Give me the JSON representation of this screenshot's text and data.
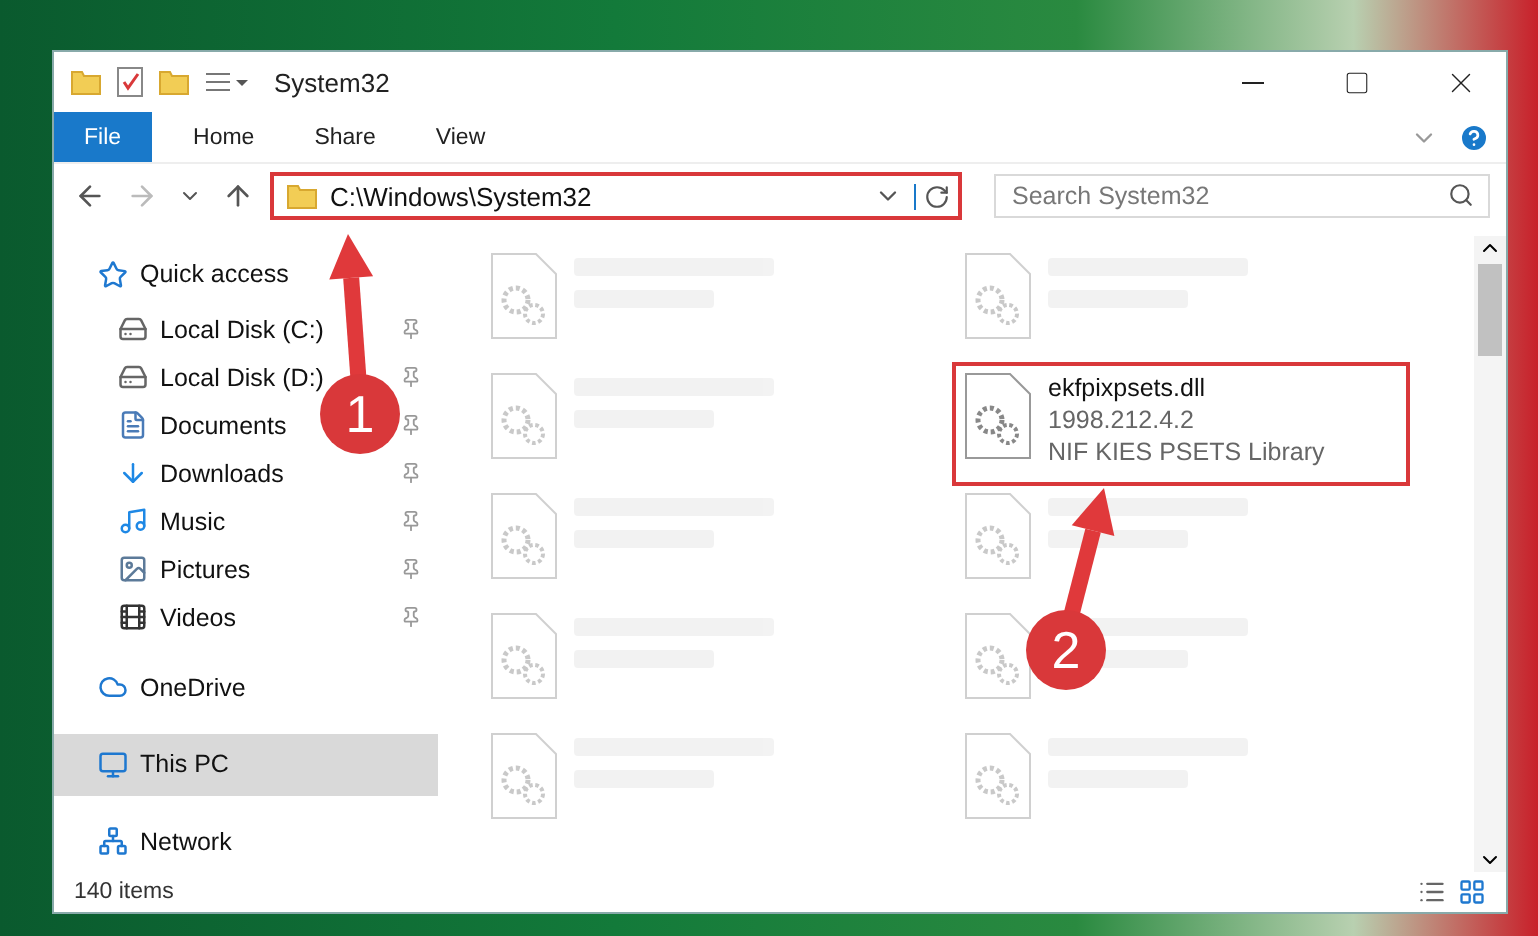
{
  "window": {
    "title": "System32"
  },
  "ribbon": {
    "tabs": [
      {
        "label": "File",
        "kind": "file",
        "selected": false
      },
      {
        "label": "Home",
        "kind": "tab",
        "selected": false
      },
      {
        "label": "Share",
        "kind": "tab",
        "selected": false
      },
      {
        "label": "View",
        "kind": "tab",
        "selected": false
      }
    ]
  },
  "address_bar": {
    "path": "C:\\Windows\\System32",
    "highlighted": true
  },
  "search": {
    "placeholder": "Search System32"
  },
  "navigation": [
    {
      "label": "Quick access",
      "selected": false,
      "children": [
        {
          "label": "Local Disk (C:)",
          "pinned": true
        },
        {
          "label": "Local Disk (D:)",
          "pinned": true
        },
        {
          "label": "Documents",
          "pinned": true
        },
        {
          "label": "Downloads",
          "pinned": true
        },
        {
          "label": "Music",
          "pinned": true
        },
        {
          "label": "Pictures",
          "pinned": true
        },
        {
          "label": "Videos",
          "pinned": true
        }
      ]
    },
    {
      "label": "OneDrive",
      "selected": false
    },
    {
      "label": "This PC",
      "selected": true
    },
    {
      "label": "Network",
      "selected": false
    }
  ],
  "files": [
    {
      "blurred": true,
      "highlighted": false
    },
    {
      "blurred": true,
      "highlighted": false
    },
    {
      "blurred": true,
      "highlighted": false
    },
    {
      "name": "ekfpixpsets.dll",
      "details": [
        "1998.212.4.2",
        "NIF KIES PSETS Library"
      ],
      "blurred": false,
      "highlighted": true
    },
    {
      "blurred": true,
      "highlighted": false
    },
    {
      "blurred": true,
      "highlighted": false
    },
    {
      "blurred": true,
      "highlighted": false
    },
    {
      "blurred": true,
      "highlighted": false
    },
    {
      "blurred": true,
      "highlighted": false
    },
    {
      "blurred": true,
      "highlighted": false
    }
  ],
  "status_bar": {
    "item_count": "140 items"
  },
  "annotations": [
    {
      "number": "1"
    },
    {
      "number": "2"
    }
  ]
}
